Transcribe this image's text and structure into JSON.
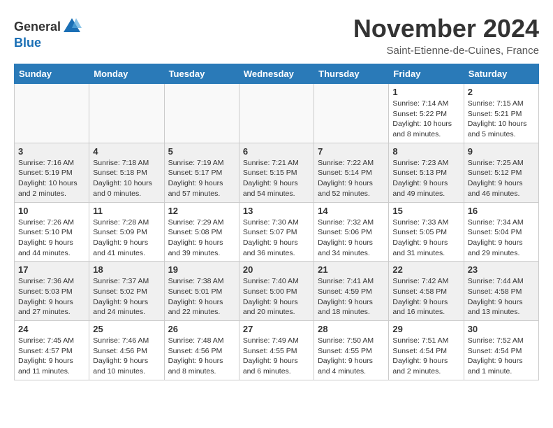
{
  "header": {
    "logo_general": "General",
    "logo_blue": "Blue",
    "title": "November 2024",
    "subtitle": "Saint-Etienne-de-Cuines, France"
  },
  "weekdays": [
    "Sunday",
    "Monday",
    "Tuesday",
    "Wednesday",
    "Thursday",
    "Friday",
    "Saturday"
  ],
  "weeks": [
    {
      "days": [
        {
          "num": "",
          "info": ""
        },
        {
          "num": "",
          "info": ""
        },
        {
          "num": "",
          "info": ""
        },
        {
          "num": "",
          "info": ""
        },
        {
          "num": "",
          "info": ""
        },
        {
          "num": "1",
          "info": "Sunrise: 7:14 AM\nSunset: 5:22 PM\nDaylight: 10 hours and 8 minutes."
        },
        {
          "num": "2",
          "info": "Sunrise: 7:15 AM\nSunset: 5:21 PM\nDaylight: 10 hours and 5 minutes."
        }
      ]
    },
    {
      "days": [
        {
          "num": "3",
          "info": "Sunrise: 7:16 AM\nSunset: 5:19 PM\nDaylight: 10 hours and 2 minutes."
        },
        {
          "num": "4",
          "info": "Sunrise: 7:18 AM\nSunset: 5:18 PM\nDaylight: 10 hours and 0 minutes."
        },
        {
          "num": "5",
          "info": "Sunrise: 7:19 AM\nSunset: 5:17 PM\nDaylight: 9 hours and 57 minutes."
        },
        {
          "num": "6",
          "info": "Sunrise: 7:21 AM\nSunset: 5:15 PM\nDaylight: 9 hours and 54 minutes."
        },
        {
          "num": "7",
          "info": "Sunrise: 7:22 AM\nSunset: 5:14 PM\nDaylight: 9 hours and 52 minutes."
        },
        {
          "num": "8",
          "info": "Sunrise: 7:23 AM\nSunset: 5:13 PM\nDaylight: 9 hours and 49 minutes."
        },
        {
          "num": "9",
          "info": "Sunrise: 7:25 AM\nSunset: 5:12 PM\nDaylight: 9 hours and 46 minutes."
        }
      ]
    },
    {
      "days": [
        {
          "num": "10",
          "info": "Sunrise: 7:26 AM\nSunset: 5:10 PM\nDaylight: 9 hours and 44 minutes."
        },
        {
          "num": "11",
          "info": "Sunrise: 7:28 AM\nSunset: 5:09 PM\nDaylight: 9 hours and 41 minutes."
        },
        {
          "num": "12",
          "info": "Sunrise: 7:29 AM\nSunset: 5:08 PM\nDaylight: 9 hours and 39 minutes."
        },
        {
          "num": "13",
          "info": "Sunrise: 7:30 AM\nSunset: 5:07 PM\nDaylight: 9 hours and 36 minutes."
        },
        {
          "num": "14",
          "info": "Sunrise: 7:32 AM\nSunset: 5:06 PM\nDaylight: 9 hours and 34 minutes."
        },
        {
          "num": "15",
          "info": "Sunrise: 7:33 AM\nSunset: 5:05 PM\nDaylight: 9 hours and 31 minutes."
        },
        {
          "num": "16",
          "info": "Sunrise: 7:34 AM\nSunset: 5:04 PM\nDaylight: 9 hours and 29 minutes."
        }
      ]
    },
    {
      "days": [
        {
          "num": "17",
          "info": "Sunrise: 7:36 AM\nSunset: 5:03 PM\nDaylight: 9 hours and 27 minutes."
        },
        {
          "num": "18",
          "info": "Sunrise: 7:37 AM\nSunset: 5:02 PM\nDaylight: 9 hours and 24 minutes."
        },
        {
          "num": "19",
          "info": "Sunrise: 7:38 AM\nSunset: 5:01 PM\nDaylight: 9 hours and 22 minutes."
        },
        {
          "num": "20",
          "info": "Sunrise: 7:40 AM\nSunset: 5:00 PM\nDaylight: 9 hours and 20 minutes."
        },
        {
          "num": "21",
          "info": "Sunrise: 7:41 AM\nSunset: 4:59 PM\nDaylight: 9 hours and 18 minutes."
        },
        {
          "num": "22",
          "info": "Sunrise: 7:42 AM\nSunset: 4:58 PM\nDaylight: 9 hours and 16 minutes."
        },
        {
          "num": "23",
          "info": "Sunrise: 7:44 AM\nSunset: 4:58 PM\nDaylight: 9 hours and 13 minutes."
        }
      ]
    },
    {
      "days": [
        {
          "num": "24",
          "info": "Sunrise: 7:45 AM\nSunset: 4:57 PM\nDaylight: 9 hours and 11 minutes."
        },
        {
          "num": "25",
          "info": "Sunrise: 7:46 AM\nSunset: 4:56 PM\nDaylight: 9 hours and 10 minutes."
        },
        {
          "num": "26",
          "info": "Sunrise: 7:48 AM\nSunset: 4:56 PM\nDaylight: 9 hours and 8 minutes."
        },
        {
          "num": "27",
          "info": "Sunrise: 7:49 AM\nSunset: 4:55 PM\nDaylight: 9 hours and 6 minutes."
        },
        {
          "num": "28",
          "info": "Sunrise: 7:50 AM\nSunset: 4:55 PM\nDaylight: 9 hours and 4 minutes."
        },
        {
          "num": "29",
          "info": "Sunrise: 7:51 AM\nSunset: 4:54 PM\nDaylight: 9 hours and 2 minutes."
        },
        {
          "num": "30",
          "info": "Sunrise: 7:52 AM\nSunset: 4:54 PM\nDaylight: 9 hours and 1 minute."
        }
      ]
    }
  ]
}
